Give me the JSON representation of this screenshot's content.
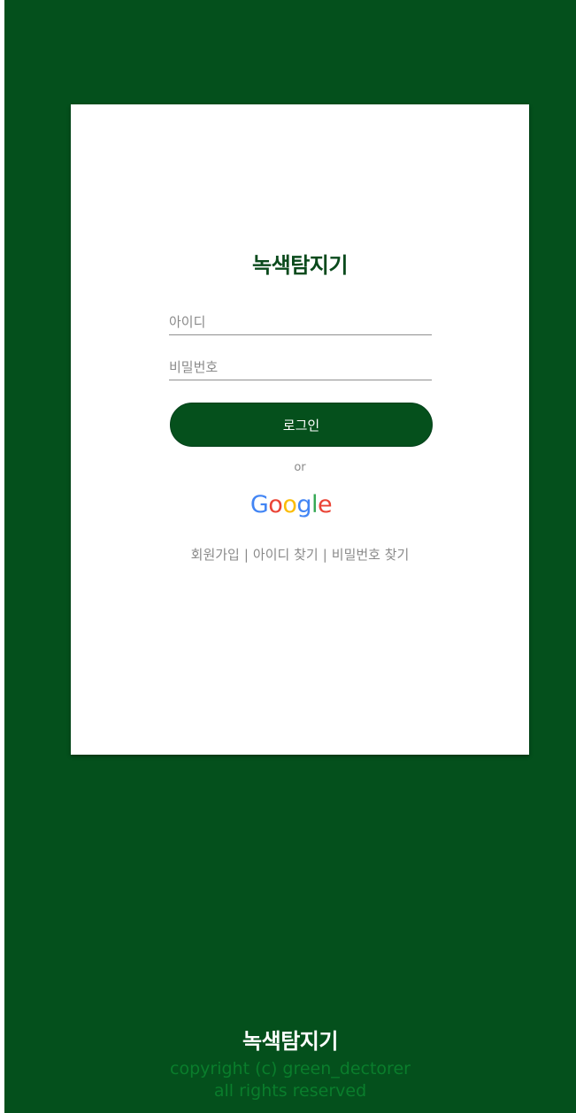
{
  "app": {
    "title": "녹색탐지기"
  },
  "login_form": {
    "id_placeholder": "아이디",
    "password_placeholder": "비밀번호",
    "login_button_label": "로그인",
    "or_text": "or",
    "google_letters": [
      "G",
      "o",
      "o",
      "g",
      "l",
      "e"
    ],
    "google_colors": [
      "#4285F4",
      "#EA4335",
      "#FBBC05",
      "#4285F4",
      "#34A853",
      "#EA4335"
    ]
  },
  "links": {
    "signup": "회원가입",
    "find_id": "아이디 찾기",
    "find_password": "비밀번호 찾기",
    "separator": "|"
  },
  "footer": {
    "logo": "녹색탐지기",
    "copyright_line1": "copyright (c) green_dectorer",
    "copyright_line2": "all rights reserved"
  },
  "colors": {
    "brand_green": "#04501c",
    "footer_text_green": "#0a7d2c"
  }
}
